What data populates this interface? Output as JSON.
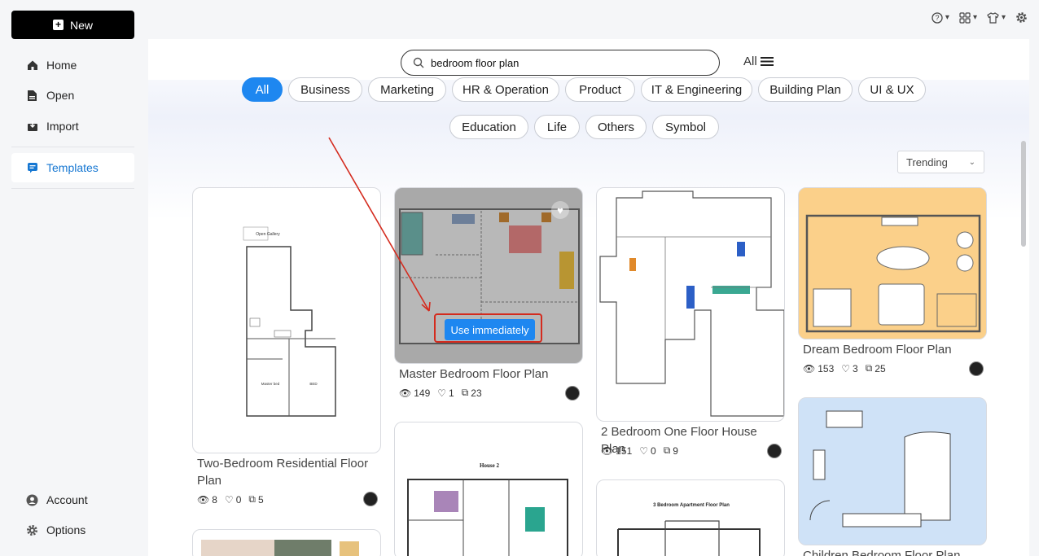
{
  "sidebar": {
    "new_label": "New",
    "items": [
      {
        "label": "Home",
        "icon": "home-icon"
      },
      {
        "label": "Open",
        "icon": "file-icon"
      },
      {
        "label": "Import",
        "icon": "import-icon"
      },
      {
        "label": "Templates",
        "icon": "templates-icon"
      }
    ],
    "bottom": [
      {
        "label": "Account",
        "icon": "account-icon"
      },
      {
        "label": "Options",
        "icon": "gear-icon"
      }
    ]
  },
  "search": {
    "value": "bedroom floor plan",
    "filter_label": "All"
  },
  "categories": [
    "All",
    "Business",
    "Marketing",
    "HR & Operation",
    "Product",
    "IT & Engineering",
    "Building Plan",
    "UI & UX",
    "Education",
    "Life",
    "Others",
    "Symbol"
  ],
  "sort": {
    "selected": "Trending"
  },
  "templates": [
    {
      "title": "Two-Bedroom Residential Floor Plan",
      "views": "8",
      "likes": "0",
      "copies": "5"
    },
    {
      "title": "Master Bedroom Floor Plan",
      "views": "149",
      "likes": "1",
      "copies": "23",
      "action_label": "Use immediately"
    },
    {
      "title": "2 Bedroom One Floor House Plan",
      "views": "151",
      "likes": "0",
      "copies": "9"
    },
    {
      "title": "Dream Bedroom Floor Plan",
      "views": "153",
      "likes": "3",
      "copies": "25"
    },
    {
      "title": "Children Bedroom Floor Plan"
    }
  ],
  "thumb_text": {
    "house2": "House 2",
    "apt": "3 Bedroom Apartment Floor Plan",
    "open_gallery": "Open Gallery",
    "master_bed": "Master bed",
    "bed": "BED"
  },
  "colors": {
    "accent": "#1e87f0",
    "highlight": "#d42b1e"
  }
}
